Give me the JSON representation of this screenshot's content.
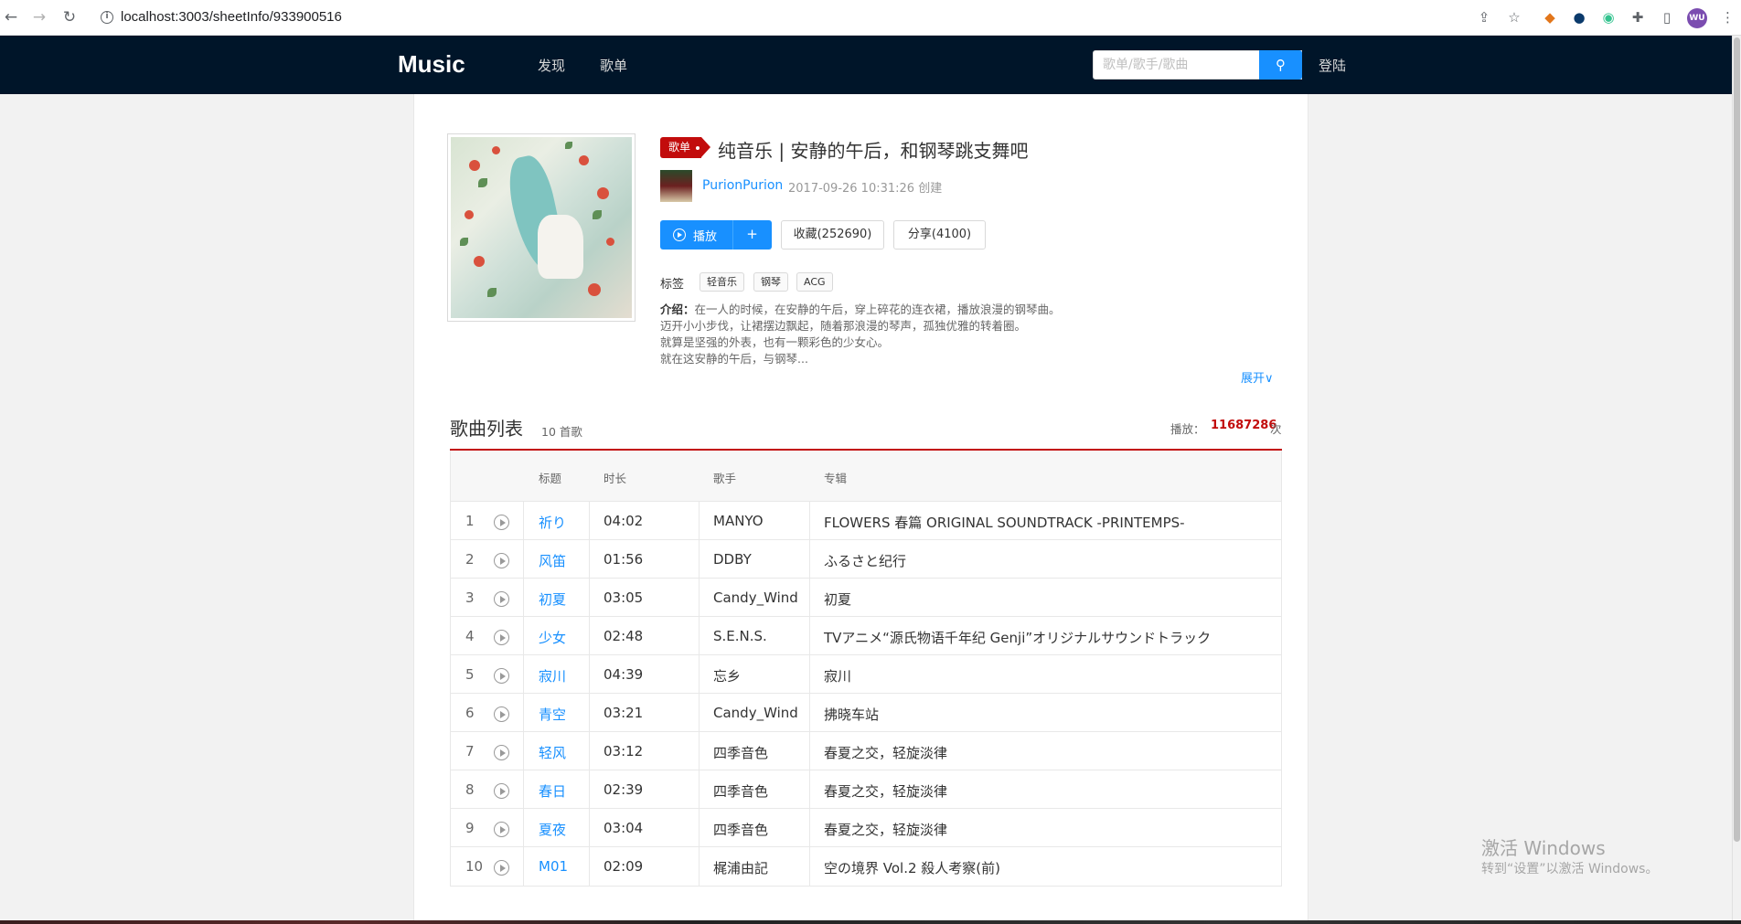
{
  "browser": {
    "url": "localhost:3003/sheetInfo/933900516",
    "profile_initials": "WU"
  },
  "header": {
    "logo": "Music",
    "nav": [
      "发现",
      "歌单"
    ],
    "search_placeholder": "歌单/歌手/歌曲",
    "login": "登陆"
  },
  "sheet": {
    "badge": "歌单",
    "title": "纯音乐 | 安静的午后，和钢琴跳支舞吧",
    "creator": "PurionPurion",
    "created": "2017-09-26 10:31:26 创建",
    "play_label": "播放",
    "play_plus": "+",
    "collect_label": "收藏(252690)",
    "share_label": "分享(4100)",
    "tags_label": "标签",
    "tags": [
      "轻音乐",
      "钢琴",
      "ACG"
    ],
    "desc_label": "介绍：",
    "desc_lines": [
      "在一人的时候，在安静的午后，穿上碎花的连衣裙，播放浪漫的钢琴曲。",
      "迈开小小步伐，让裙摆边飘起，随着那浪漫的琴声，孤独优雅的转着圈。",
      "就算是坚强的外表，也有一颗彩色的少女心。",
      "就在这安静的午后，与钢琴..."
    ],
    "expand": "展开∨"
  },
  "song_list": {
    "title": "歌曲列表",
    "count": "10 首歌",
    "play_count_label": "播放：",
    "play_count": "11687286",
    "play_count_unit": "次",
    "columns": [
      "标题",
      "时长",
      "歌手",
      "专辑"
    ],
    "rows": [
      {
        "num": "1",
        "name": "祈り",
        "duration": "04:02",
        "artist": "MANYO",
        "album": "FLOWERS 春篇 ORIGINAL SOUNDTRACK -PRINTEMPS-"
      },
      {
        "num": "2",
        "name": "风笛",
        "duration": "01:56",
        "artist": "DDBY",
        "album": "ふるさと纪行"
      },
      {
        "num": "3",
        "name": "初夏",
        "duration": "03:05",
        "artist": "Candy_Wind",
        "album": "初夏"
      },
      {
        "num": "4",
        "name": "少女",
        "duration": "02:48",
        "artist": "S.E.N.S.",
        "album": "TVアニメ“源氏物语千年纪 Genji”オリジナルサウンドトラック"
      },
      {
        "num": "5",
        "name": "寂川",
        "duration": "04:39",
        "artist": "忘乡",
        "album": "寂川"
      },
      {
        "num": "6",
        "name": "青空",
        "duration": "03:21",
        "artist": "Candy_Wind",
        "album": "拂晓车站"
      },
      {
        "num": "7",
        "name": "轻风",
        "duration": "03:12",
        "artist": "四季音色",
        "album": "春夏之交，轻旋淡律"
      },
      {
        "num": "8",
        "name": "春日",
        "duration": "02:39",
        "artist": "四季音色",
        "album": "春夏之交，轻旋淡律"
      },
      {
        "num": "9",
        "name": "夏夜",
        "duration": "03:04",
        "artist": "四季音色",
        "album": "春夏之交，轻旋淡律"
      },
      {
        "num": "10",
        "name": "M01",
        "duration": "02:09",
        "artist": "梶浦由記",
        "album": "空の境界 Vol.2 殺人考察(前)"
      }
    ]
  },
  "watermark": {
    "line1": "激活 Windows",
    "line2": "转到“设置”以激活 Windows。"
  }
}
